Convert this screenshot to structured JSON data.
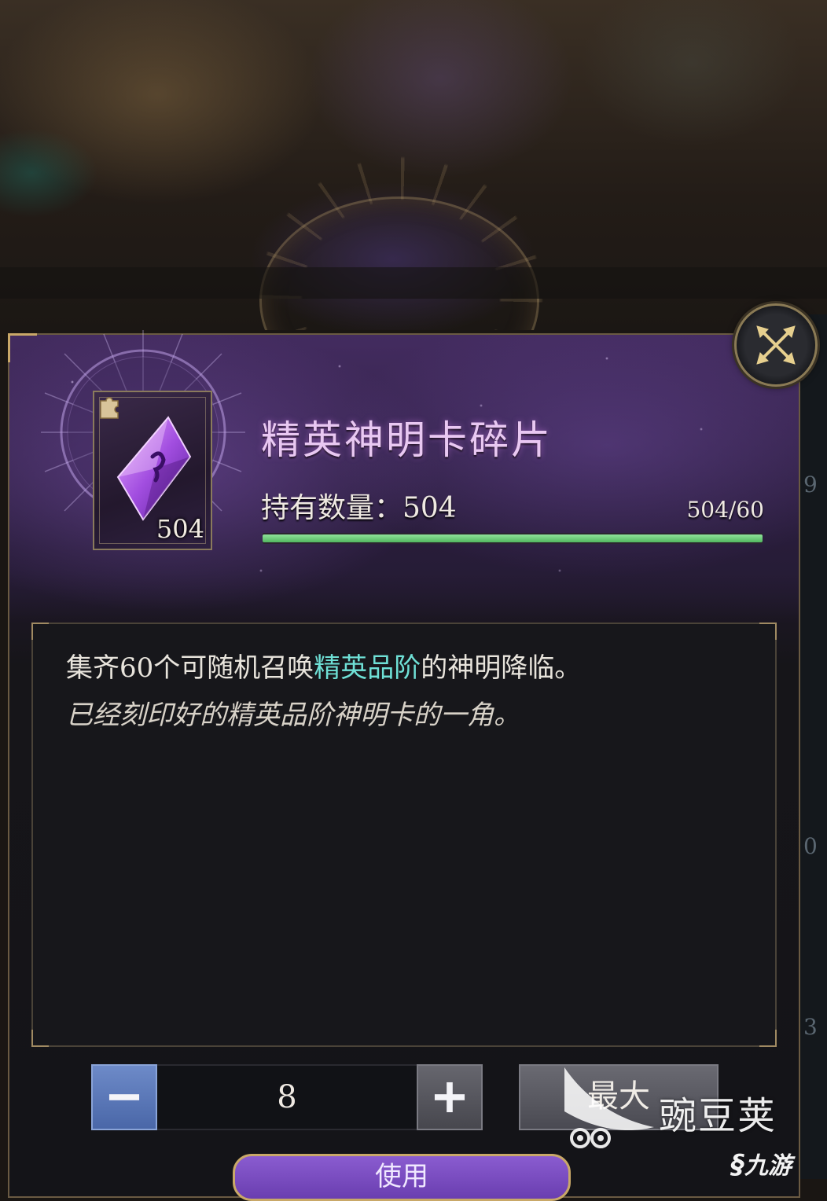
{
  "item": {
    "name": "精英神明卡碎片",
    "card_count": "504",
    "owned_label": "持有数量：504",
    "progress_text": "504/60",
    "progress_fraction": 1.0,
    "progress_color": "#5cc46a",
    "title_color": "#e9c8f2",
    "icon": "purple-gem-icon"
  },
  "description": {
    "line1_pre": "集齐60个可随机召唤",
    "line1_highlight": "精英品阶",
    "line1_post": "的神明降临。",
    "line2": "已经刻印好的精英品阶神明卡的一角。",
    "highlight_color": "#6fe0d6"
  },
  "quantity": {
    "minus_icon": "minus-icon",
    "value": "8",
    "plus_icon": "plus-icon",
    "max_label": "最大"
  },
  "use_button": {
    "label": "使用"
  },
  "close_icon": "close-crossed-arrows-icon",
  "side_numbers": [
    "9",
    "0",
    "3"
  ],
  "watermarks": {
    "wandoujia": "豌豆荚",
    "jiuyou": "九游"
  }
}
